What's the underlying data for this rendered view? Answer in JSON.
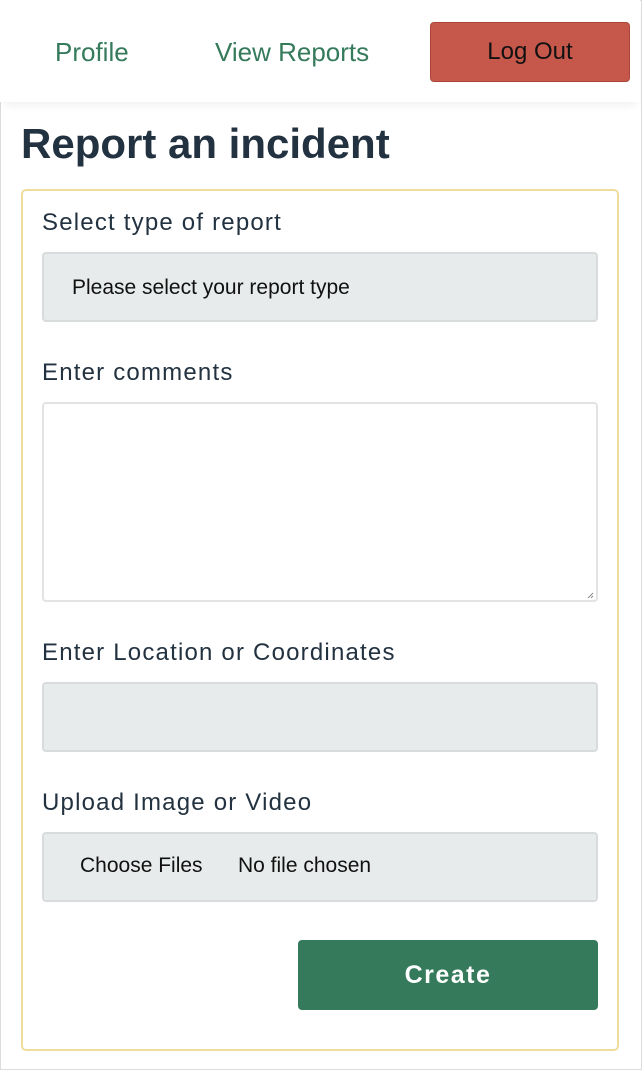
{
  "nav": {
    "profile_label": "Profile",
    "reports_label": "View Reports",
    "logout_label": "Log Out"
  },
  "page": {
    "title": "Report an incident"
  },
  "form": {
    "type_label": "Select type of report",
    "type_selected": "Please select your report type",
    "comments_label": "Enter comments",
    "comments_value": "",
    "location_label": "Enter Location or Coordinates",
    "location_value": "",
    "upload_label": "Upload Image or Video",
    "choose_files_label": "Choose Files",
    "file_status": "No file chosen",
    "submit_label": "Create"
  },
  "colors": {
    "accent_green": "#357a5b",
    "logout_red": "#c5584b",
    "card_border": "#f0dc9e",
    "field_bg": "#e8ebeb",
    "text_dark": "#233240"
  },
  "icons": {
    "resize_grip": "resize-grip-icon"
  }
}
